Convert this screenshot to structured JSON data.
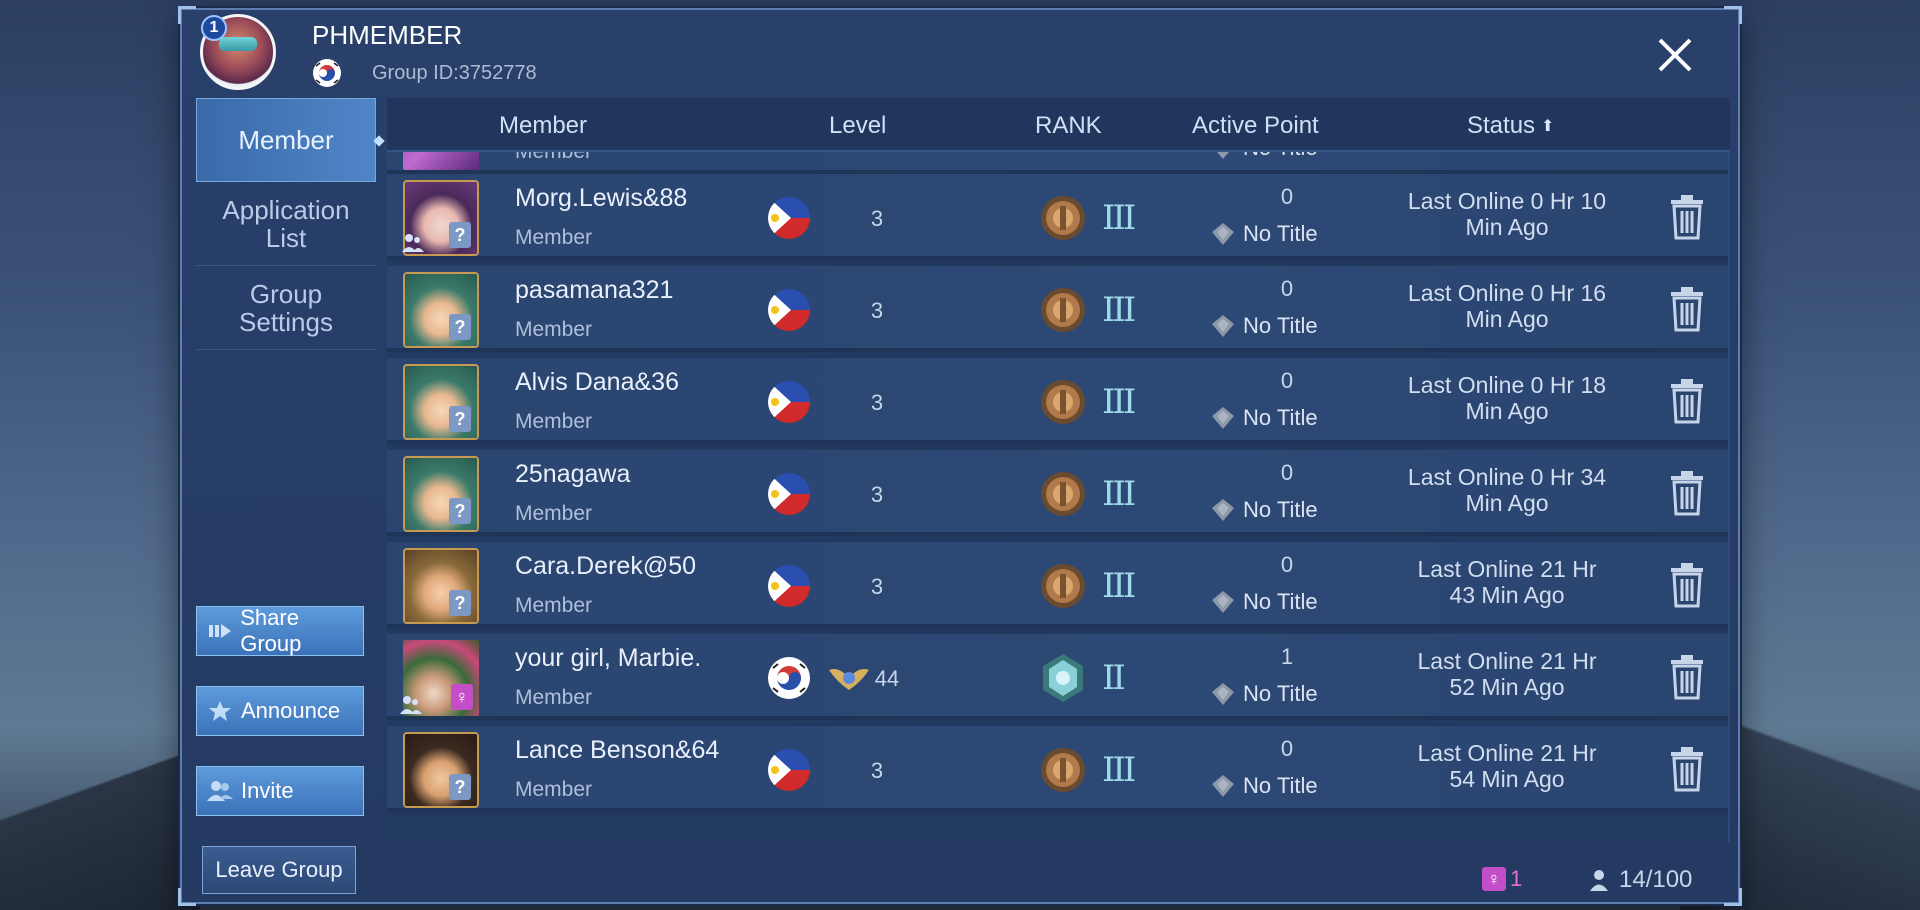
{
  "header": {
    "group_name": "PHMEMBER",
    "group_id": "Group ID:3752778",
    "group_level": "1",
    "group_flag": "korea",
    "close_icon": "close-icon"
  },
  "sidebar": {
    "tabs": [
      {
        "label": "Member",
        "active": true
      },
      {
        "label": "Application\nList",
        "active": false
      },
      {
        "label": "Group\nSettings",
        "active": false
      }
    ],
    "buttons": {
      "share": "Share Group",
      "announce": "Announce",
      "invite": "Invite",
      "leave": "Leave Group"
    }
  },
  "table": {
    "headers": {
      "member": "Member",
      "level": "Level",
      "rank": "RANK",
      "active_point": "Active Point",
      "status": "Status"
    },
    "partial_row": {
      "role": "Member",
      "title": "No Title"
    },
    "rows": [
      {
        "name": "Morg.Lewis&88",
        "role": "Member",
        "flag": "philippines",
        "level": "3",
        "rank_tier": "III",
        "active_point": "0",
        "title": "No Title",
        "status": "Last Online 0 Hr 10\nMin Ago",
        "avatar": "purple-hair",
        "female": false
      },
      {
        "name": "pasamana321",
        "role": "Member",
        "flag": "philippines",
        "level": "3",
        "rank_tier": "III",
        "active_point": "0",
        "title": "No Title",
        "status": "Last Online 0 Hr 16\nMin Ago",
        "avatar": "teal-hair",
        "female": false
      },
      {
        "name": "Alvis Dana&36",
        "role": "Member",
        "flag": "philippines",
        "level": "3",
        "rank_tier": "III",
        "active_point": "0",
        "title": "No Title",
        "status": "Last Online 0 Hr 18\nMin Ago",
        "avatar": "teal-hair",
        "female": false
      },
      {
        "name": "25nagawa",
        "role": "Member",
        "flag": "philippines",
        "level": "3",
        "rank_tier": "III",
        "active_point": "0",
        "title": "No Title",
        "status": "Last Online 0 Hr 34\nMin Ago",
        "avatar": "teal-hair",
        "female": false
      },
      {
        "name": "Cara.Derek@50",
        "role": "Member",
        "flag": "philippines",
        "level": "3",
        "rank_tier": "III",
        "active_point": "0",
        "title": "No Title",
        "status": "Last Online 21 Hr\n43 Min Ago",
        "avatar": "goggles",
        "female": false
      },
      {
        "name": "your girl, Marbie.",
        "role": "Member",
        "flag": "korea",
        "level": "44",
        "rank_tier": "II",
        "active_point": "1",
        "title": "No Title",
        "status": "Last Online 21 Hr\n52 Min Ago",
        "avatar": "flowers",
        "female": true
      },
      {
        "name": "Lance Benson&64",
        "role": "Member",
        "flag": "philippines",
        "level": "3",
        "rank_tier": "III",
        "active_point": "0",
        "title": "No Title",
        "status": "Last Online 21 Hr\n54 Min Ago",
        "avatar": "dark-hair",
        "female": false
      }
    ]
  },
  "footer": {
    "female_icon": "♀",
    "female_count": "1",
    "member_count": "14/100"
  },
  "colors": {
    "panel": "#28406a",
    "accent": "#4f86c8",
    "female": "#c44dc8"
  }
}
